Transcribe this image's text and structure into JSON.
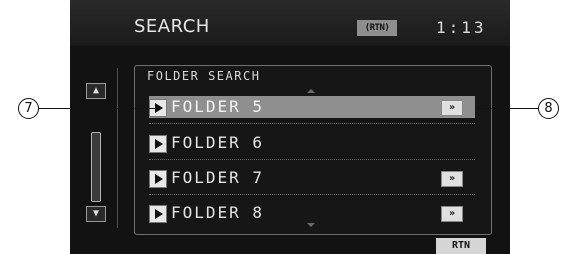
{
  "header": {
    "title": "SEARCH",
    "rtn_badge": "⟨RTN⟩",
    "clock": "1:13"
  },
  "sidebar": {
    "top_icon": "▲̲",
    "bottom_icon": "▼̲"
  },
  "panel": {
    "heading": "FOLDER SEARCH",
    "rows": [
      {
        "label": "FOLDER 5",
        "more": "⮞⮞",
        "selected": true,
        "has_more": true
      },
      {
        "label": "FOLDER 6",
        "more": "",
        "selected": false,
        "has_more": false
      },
      {
        "label": "FOLDER 7",
        "more": "⮞⮞",
        "selected": false,
        "has_more": true
      },
      {
        "label": "FOLDER 8",
        "more": "⮞⮞",
        "selected": false,
        "has_more": true
      }
    ]
  },
  "footer": {
    "rtn_button": "RTN"
  },
  "callouts": {
    "left": "7",
    "right": "8"
  },
  "colors": {
    "selected_row": "#8f8f8f",
    "screen_bg": "#121212"
  }
}
